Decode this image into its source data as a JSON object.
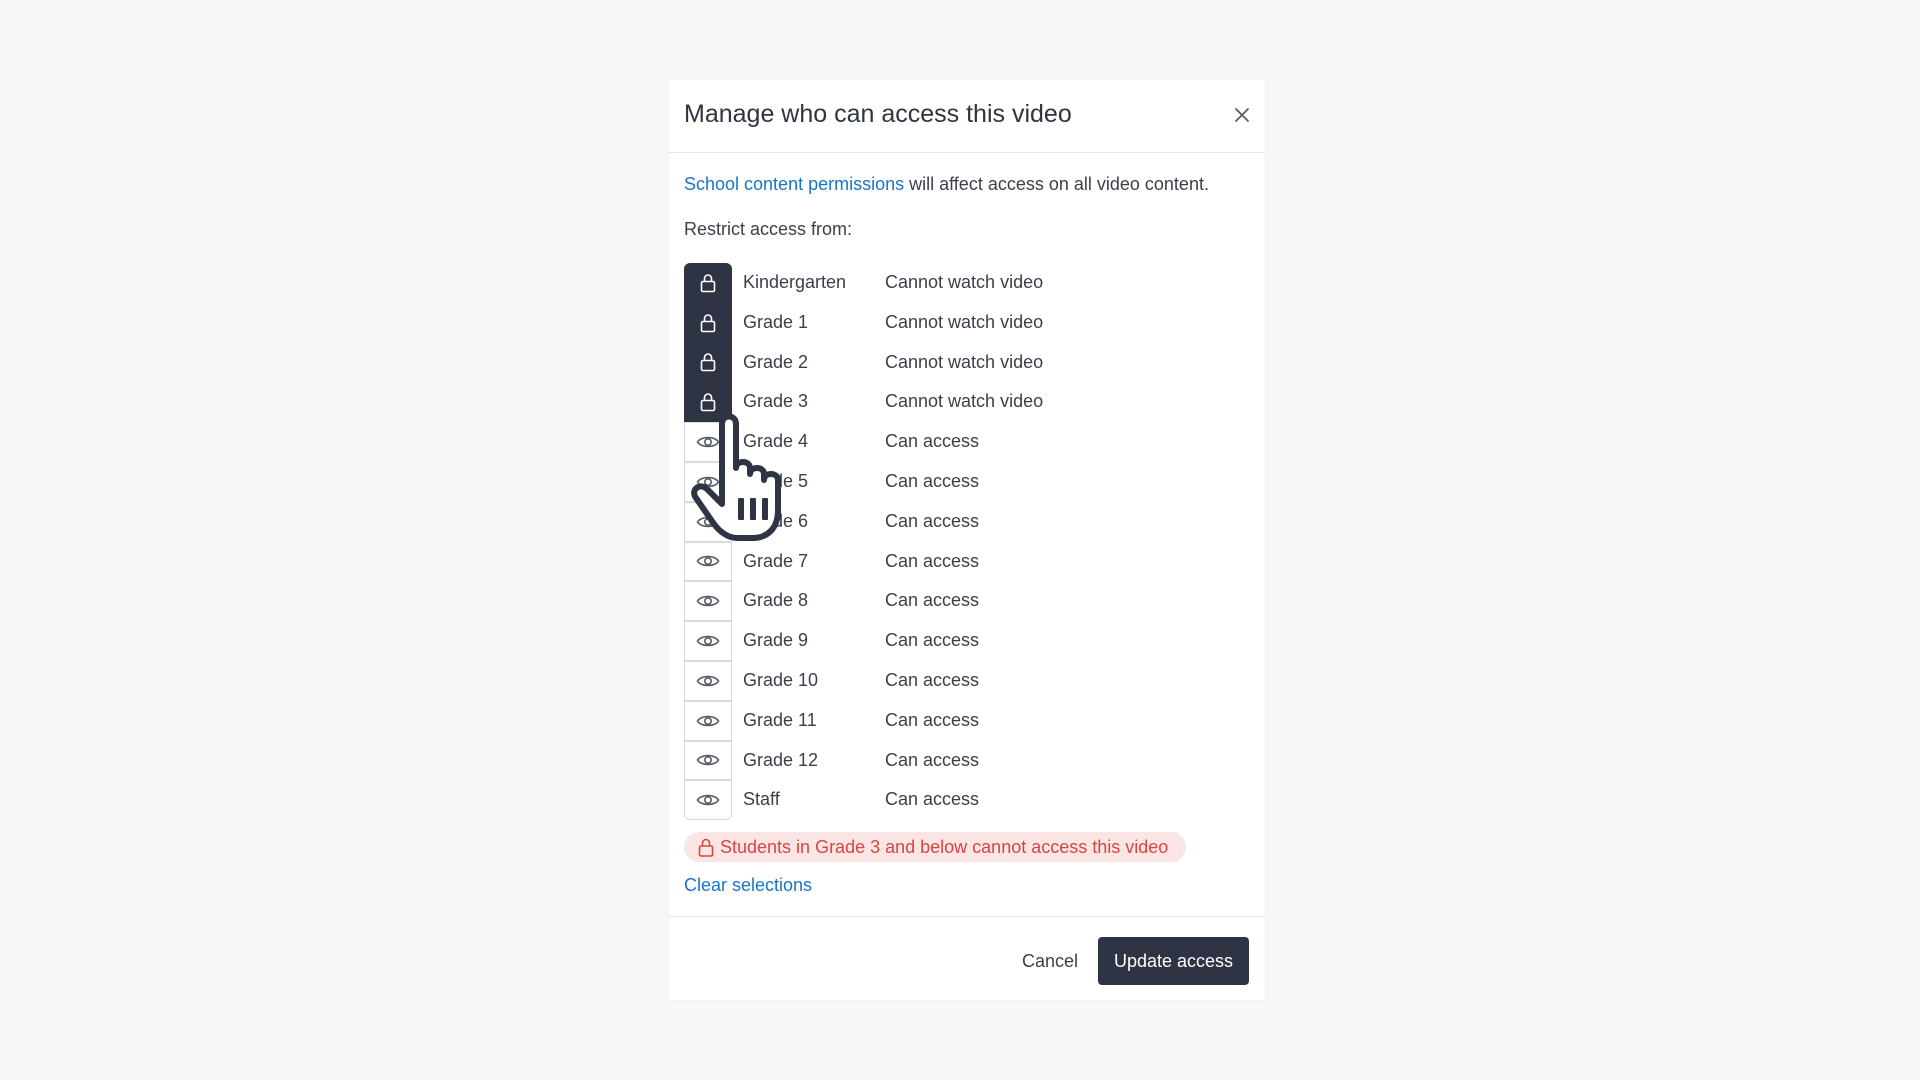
{
  "dialog": {
    "title": "Manage who can access this video",
    "close_icon": "close-icon",
    "intro_link": "School content permissions",
    "intro_rest": " will affect access on all video content.",
    "restrict_label": "Restrict access from:",
    "rows": [
      {
        "name": "Kindergarten",
        "status": "Cannot watch video",
        "icon": "lock-icon"
      },
      {
        "name": "Grade 1",
        "status": "Cannot watch video",
        "icon": "lock-icon"
      },
      {
        "name": "Grade 2",
        "status": "Cannot watch video",
        "icon": "lock-icon"
      },
      {
        "name": "Grade 3",
        "status": "Cannot watch video",
        "icon": "lock-icon"
      },
      {
        "name": "Grade 4",
        "status": "Can access",
        "icon": "eye-icon"
      },
      {
        "name": "Grade 5",
        "status": "Can access",
        "icon": "eye-icon"
      },
      {
        "name": "Grade 6",
        "status": "Can access",
        "icon": "eye-icon"
      },
      {
        "name": "Grade 7",
        "status": "Can access",
        "icon": "eye-icon"
      },
      {
        "name": "Grade 8",
        "status": "Can access",
        "icon": "eye-icon"
      },
      {
        "name": "Grade 9",
        "status": "Can access",
        "icon": "eye-icon"
      },
      {
        "name": "Grade 10",
        "status": "Can access",
        "icon": "eye-icon"
      },
      {
        "name": "Grade 11",
        "status": "Can access",
        "icon": "eye-icon"
      },
      {
        "name": "Grade 12",
        "status": "Can access",
        "icon": "eye-icon"
      },
      {
        "name": "Staff",
        "status": "Can access",
        "icon": "eye-icon"
      }
    ],
    "warning": "Students in Grade 3 and below cannot access this video",
    "clear_label": "Clear selections",
    "cancel_label": "Cancel",
    "update_label": "Update access"
  },
  "colors": {
    "background": "#f7f7f8",
    "accent_dark": "#2f3445",
    "link": "#1a74c8",
    "warning_text": "#d8453f",
    "warning_bg": "#fbe6e5"
  }
}
